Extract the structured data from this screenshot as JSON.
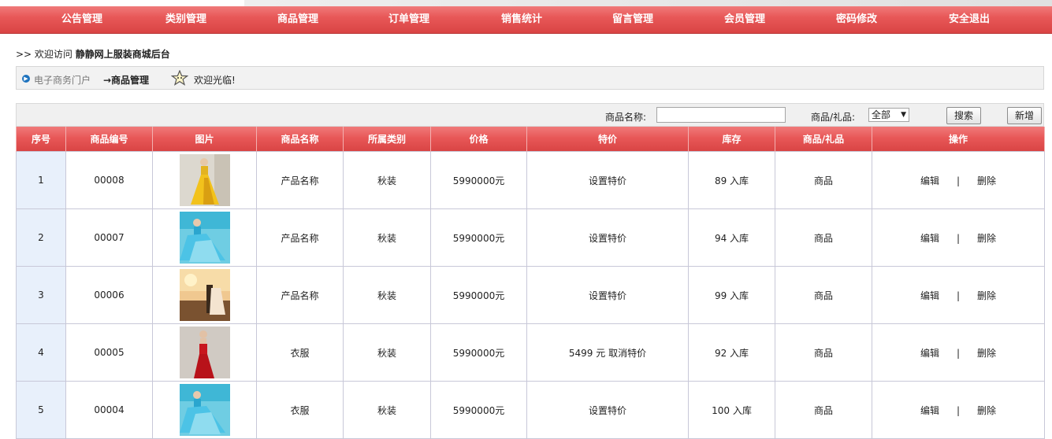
{
  "nav": [
    {
      "label": "公告管理"
    },
    {
      "label": "类别管理"
    },
    {
      "label": "商品管理"
    },
    {
      "label": "订单管理"
    },
    {
      "label": "销售统计"
    },
    {
      "label": "留言管理"
    },
    {
      "label": "会员管理"
    },
    {
      "label": "密码修改"
    },
    {
      "label": "安全退出"
    }
  ],
  "welcome": {
    "prefix": ">> 欢迎访问",
    "site_name": "静静网上服装商城后台"
  },
  "breadcrumb": {
    "portal": "电子商务门户",
    "current": "→商品管理",
    "greeting": "欢迎光临!"
  },
  "search": {
    "name_label": "商品名称:",
    "name_value": "",
    "type_label": "商品/礼品:",
    "type_selected": "全部",
    "search_button": "搜索",
    "add_button": "新增"
  },
  "table": {
    "headers": [
      "序号",
      "商品编号",
      "图片",
      "商品名称",
      "所属类别",
      "价格",
      "特价",
      "库存",
      "商品/礼品",
      "操作"
    ],
    "rows": [
      {
        "seq": "1",
        "code": "00008",
        "image": "yellow-gown-photo",
        "name": "产品名称",
        "category": "秋装",
        "price": "5990000元",
        "special": "设置特价",
        "stock": "89 入库",
        "type": "商品",
        "edit": "编辑",
        "sep": "|",
        "delete": "删除"
      },
      {
        "seq": "2",
        "code": "00007",
        "image": "blue-gown-photo",
        "name": "产品名称",
        "category": "秋装",
        "price": "5990000元",
        "special": "设置特价",
        "stock": "94 入库",
        "type": "商品",
        "edit": "编辑",
        "sep": "|",
        "delete": "删除"
      },
      {
        "seq": "3",
        "code": "00006",
        "image": "sunset-couple-photo",
        "name": "产品名称",
        "category": "秋装",
        "price": "5990000元",
        "special": "设置特价",
        "stock": "99 入库",
        "type": "商品",
        "edit": "编辑",
        "sep": "|",
        "delete": "删除"
      },
      {
        "seq": "4",
        "code": "00005",
        "image": "red-dress-photo",
        "name": "衣服",
        "category": "秋装",
        "price": "5990000元",
        "special": "5499 元 取消特价",
        "stock": "92 入库",
        "type": "商品",
        "edit": "编辑",
        "sep": "|",
        "delete": "删除"
      },
      {
        "seq": "5",
        "code": "00004",
        "image": "blue-gown-photo",
        "name": "衣服",
        "category": "秋装",
        "price": "5990000元",
        "special": "设置特价",
        "stock": "100 入库",
        "type": "商品",
        "edit": "编辑",
        "sep": "|",
        "delete": "删除"
      }
    ]
  },
  "colors": {
    "nav_red": "#e85858",
    "seq_cell_bg": "#e8f0fb",
    "breadcrumb_dot": "#1e73be"
  }
}
